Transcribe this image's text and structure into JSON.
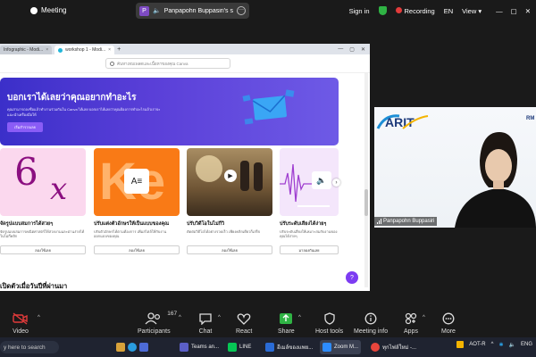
{
  "topbar": {
    "meeting_label": "Meeting",
    "share_initial": "P",
    "share_name": "Panpapohn Buppasiri's scree",
    "sign_in": "Sign in",
    "recording": "Recording",
    "language": "EN",
    "view": "View"
  },
  "browser": {
    "tabs": [
      {
        "label": "Infographic - Modi..."
      },
      {
        "label": "workshop 1 - Modi..."
      }
    ],
    "search_placeholder": "ค้นหาเทมเพลตและเนื้อหาของคุณ Canva"
  },
  "canva": {
    "hero_title": "บอกเราได้เลยว่าคุณอยากทำอะไร",
    "hero_sub": "คุณสามารถลงชื่อแล้วทำงานร่วมกันใน Canva ได้เลย บอกเราได้เลยว่าคุณต้องการทำอะไรแล้วเราจะแนะนำเครื่องมือให้",
    "hero_button": "เริ่มสำรวจเลย",
    "tiles": [
      {
        "title": "จัดรูปแบบสมการได้สวยๆ",
        "desc": "จัดรูปแบบสมการคณิตศาสตร์ให้สวยงามและอ่านง่ายได้ในไม่กี่คลิก",
        "button": "ลองใช้เลย"
      },
      {
        "title": "ปรับแต่งตัวอักษรให้เป็นแบบของคุณ",
        "desc": "ปรับตัวอักษรได้ตามต้องการ เพิ่มสไตล์ให้กับงานออกแบบของคุณ",
        "button": "ลองใช้เลย"
      },
      {
        "title": "ปรับวิดีโอในไม่กี่วิ",
        "desc": "ตัดต่อวิดีโอได้อย่างรวดเร็ว เพียงคลิกเดียวก็เสร็จ",
        "button": "ลองใช้เลย"
      },
      {
        "title": "ปรับระดับเสียงได้ง่ายๆ",
        "desc": "ปรับระดับเสียงให้เหมาะสมกับงานของคุณได้ง่ายๆ",
        "button": "มาลองกันเลย"
      }
    ],
    "tile4_partial_desc": "ได้เลย",
    "section2_title": "เปิดตัวเมื่อวันปีที่ผ่านมา",
    "help": "?"
  },
  "video": {
    "name": "Panpapohn Buppasiri",
    "rmu": "RM"
  },
  "toolbar": {
    "video": "Video",
    "participants": "Participants",
    "participant_count": "167",
    "chat": "Chat",
    "react": "React",
    "share": "Share",
    "host_tools": "Host tools",
    "meeting_info": "Meeting info",
    "apps": "Apps",
    "more": "More"
  },
  "taskbar": {
    "search": "y here to search",
    "apps": [
      {
        "label": "Teams an..."
      },
      {
        "label": "LINE"
      },
      {
        "label": "อีเมล์ของแพย..."
      },
      {
        "label": "Zoom M..."
      },
      {
        "label": "ทุกไฟล์ใหม่ -..."
      }
    ],
    "tray_label": "AOT-R",
    "lang": "ENG"
  },
  "colors": {
    "hero": "#4a37d2",
    "accent": "#7d3cf2",
    "share_green": "#2fb344",
    "record_red": "#e23b3b"
  }
}
